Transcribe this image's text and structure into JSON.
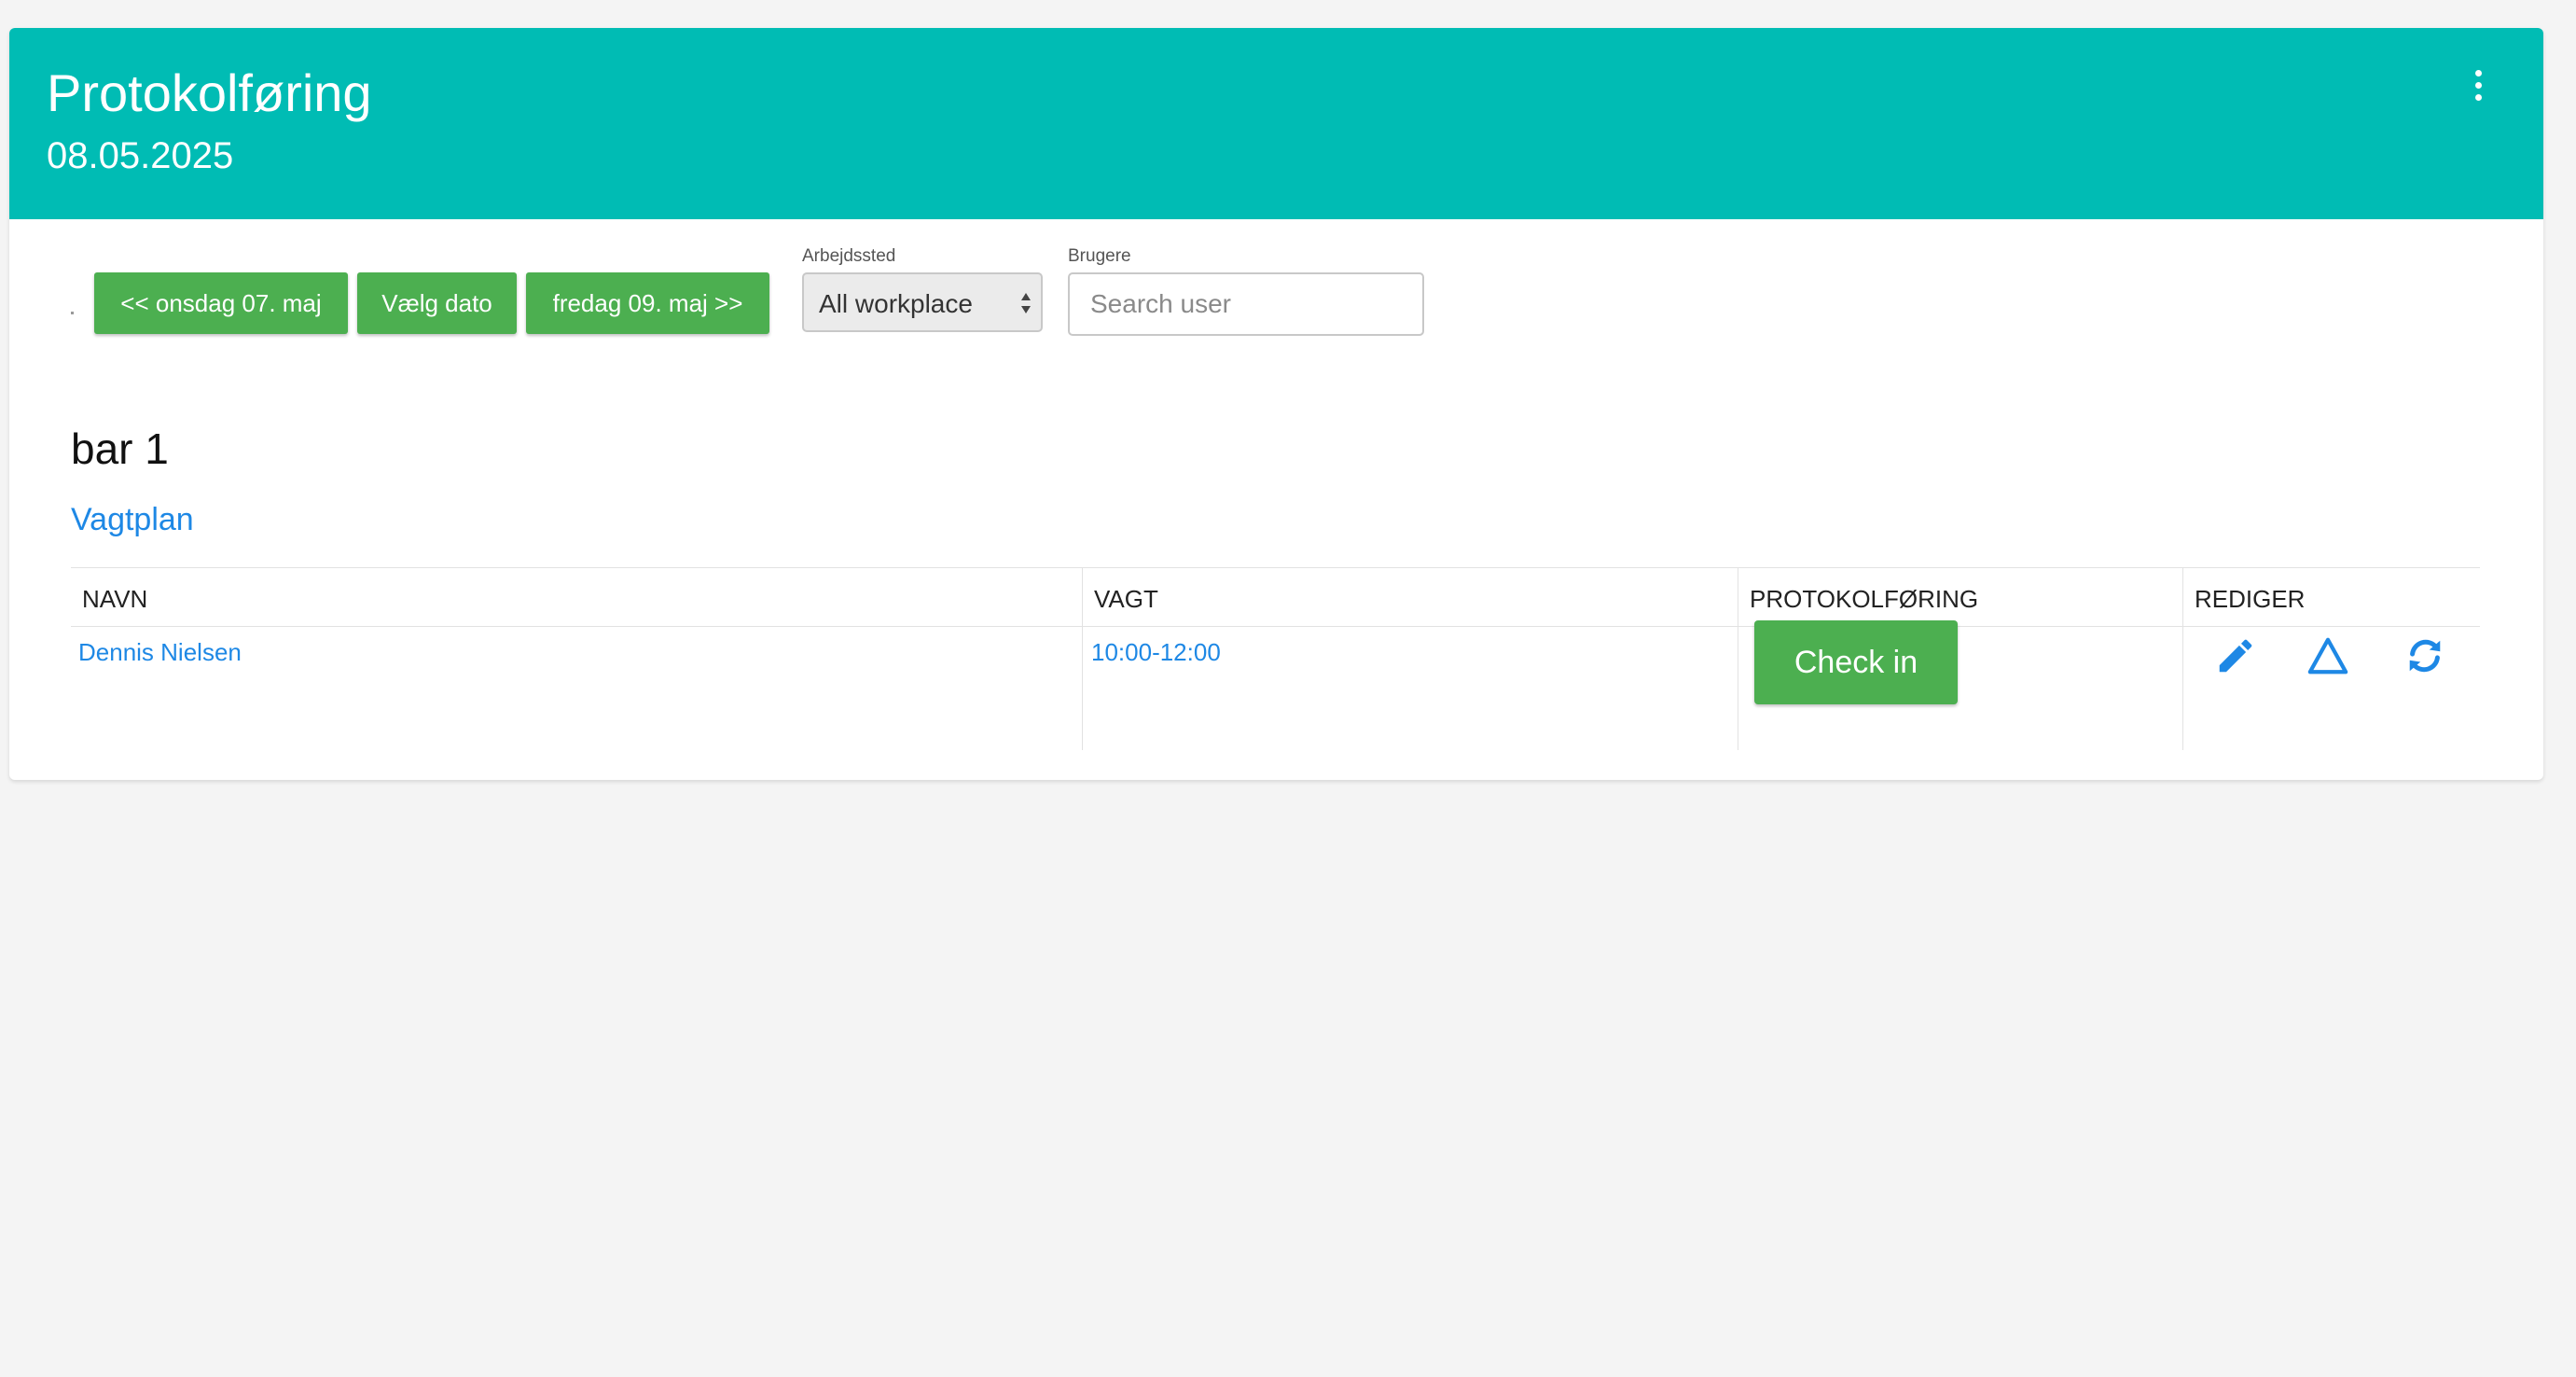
{
  "header": {
    "title": "Protokolføring",
    "date": "08.05.2025",
    "menu_icon": "more-vertical-icon"
  },
  "toolbar": {
    "prev_day": "<< onsdag 07. maj",
    "choose_date": "Vælg dato",
    "next_day": "fredag 09. maj >>",
    "workplace": {
      "label": "Arbejdssted",
      "selected": "All workplace"
    },
    "users": {
      "label": "Brugere",
      "placeholder": "Search user"
    }
  },
  "section": {
    "title": "bar 1",
    "link": "Vagtplan"
  },
  "table": {
    "headers": [
      "NAVN",
      "VAGT",
      "PROTOKOLFØRING",
      "REDIGER"
    ],
    "rows": [
      {
        "name": "Dennis Nielsen",
        "shift": "10:00-12:00",
        "action": "Check in",
        "edit_icons": [
          "pencil-icon",
          "warning-triangle-icon",
          "sync-icon"
        ]
      }
    ]
  },
  "colors": {
    "header_bg": "#00bcb4",
    "button_green": "#4caf50",
    "link_blue": "#1e88e5",
    "page_bg": "#f4f4f4"
  }
}
